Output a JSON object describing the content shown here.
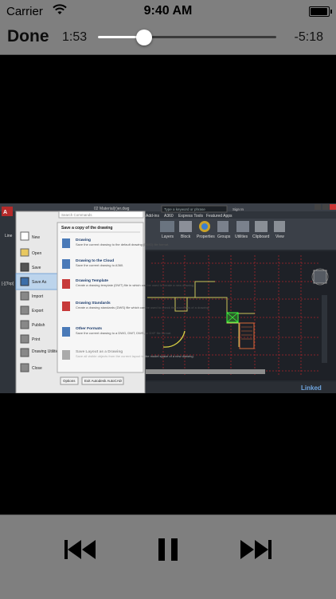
{
  "status_bar": {
    "carrier": "Carrier",
    "time": "9:40 AM",
    "battery_level": 0.95
  },
  "player": {
    "done_label": "Done",
    "elapsed": "1:53",
    "remaining": "-5:18",
    "progress": 0.26
  },
  "video": {
    "app_menu_title": "Save a copy of the drawing",
    "search_placeholder": "Search Commands",
    "tab_title": "02 Material(r)er.dwg",
    "search_box": "Type a keyword or phrase",
    "sign_in": "Sign In",
    "ribbon_tabs": [
      "Add-ins",
      "A360",
      "Express Tools",
      "Featured Apps"
    ],
    "ribbon_panels": [
      "Layers",
      "Block",
      "Properties",
      "Groups",
      "Utilities",
      "Clipboard",
      "View"
    ],
    "left_menu": [
      "New",
      "Open",
      "Save",
      "Save As",
      "Import",
      "Export",
      "Publish",
      "Print",
      "Drawing Utilities",
      "Close"
    ],
    "save_items": [
      {
        "title": "Drawing",
        "desc": "Save the current drawing to the default drawing (DWG) file format."
      },
      {
        "title": "Drawing to the Cloud",
        "desc": "Save the current drawing to A360."
      },
      {
        "title": "Drawing Template",
        "desc": "Create a drawing template (DWT) file in which can be used to create a new drawing."
      },
      {
        "title": "Drawing Standards",
        "desc": "Create a drawing standards (DWS) file which can be used to check the standards of a drawing."
      },
      {
        "title": "Other Formats",
        "desc": "Save the current drawing to a DWG, DWT, DWS, or DXF file format."
      },
      {
        "title": "Save Layout as a Drawing",
        "desc": "Save all visible objects from the current layout to the model space of a new drawing."
      }
    ],
    "options_button": "Options",
    "exit_button": "Exit Autodesk AutoCAD",
    "left_labels": [
      "Line",
      "[-][Top]"
    ],
    "watermark": "Linked"
  },
  "controls": {
    "previous_icon": "skip-back-icon",
    "pause_icon": "pause-icon",
    "next_icon": "skip-forward-icon"
  },
  "colors": {
    "bar_bg": "#7f7f7f",
    "accent": "#ffffff"
  }
}
